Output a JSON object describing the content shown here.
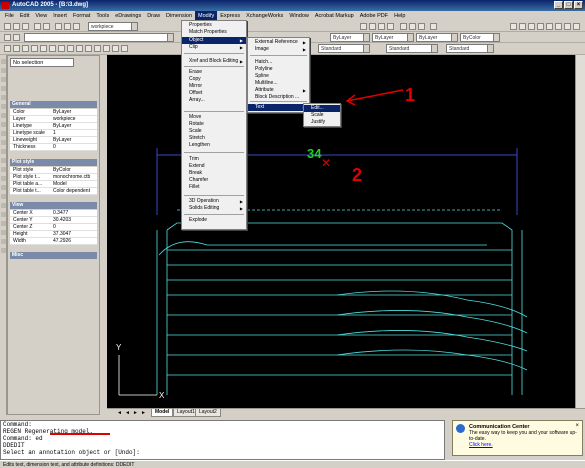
{
  "window": {
    "title": "AutoCAD 2005 - [B:\\3.dwg]"
  },
  "menubar": [
    "File",
    "Edit",
    "View",
    "Insert",
    "Format",
    "Tools",
    "eDrawings",
    "Draw",
    "Dimension",
    "Modify",
    "Express",
    "XchangeWorks",
    "Window",
    "Acrobat Markup",
    "Adobe PDF",
    "Help"
  ],
  "active_menu": "Modify",
  "toolbar": {
    "layer_value": "workpiece",
    "bylayer1": "ByLayer",
    "bylayer2": "ByLayer",
    "bylayer3": "ByLayer",
    "bycolor": "ByColor",
    "standard1": "Standard",
    "standard2": "Standard",
    "standard3": "Standard"
  },
  "properties": {
    "selection": "No selection",
    "general_header": "General",
    "general": [
      {
        "k": "Color",
        "v": "ByLayer"
      },
      {
        "k": "Layer",
        "v": "workpiece"
      },
      {
        "k": "Linetype",
        "v": "ByLayer"
      },
      {
        "k": "Linetype scale",
        "v": "1"
      },
      {
        "k": "Lineweight",
        "v": "ByLayer"
      },
      {
        "k": "Thickness",
        "v": "0"
      }
    ],
    "plot_header": "Plot style",
    "plot": [
      {
        "k": "Plot style",
        "v": "ByColor"
      },
      {
        "k": "Plot style t...",
        "v": "monochrome.ctb"
      },
      {
        "k": "Plot table a...",
        "v": "Model"
      },
      {
        "k": "Plot table t...",
        "v": "Color dependent"
      }
    ],
    "view_header": "View",
    "view": [
      {
        "k": "Center X",
        "v": "0.3477"
      },
      {
        "k": "Center Y",
        "v": "30.4203"
      },
      {
        "k": "Center Z",
        "v": "0"
      },
      {
        "k": "Height",
        "v": "37.3047"
      },
      {
        "k": "Width",
        "v": "47.2926"
      }
    ],
    "misc_header": "Misc"
  },
  "modify_menu": {
    "items": [
      "Properties",
      "Match Properties",
      "Object",
      "Clip",
      "Xref and Block Editing",
      "Erase",
      "Copy",
      "Mirror",
      "Offset",
      "Array...",
      "Move",
      "Rotate",
      "Scale",
      "Stretch",
      "Lengthen",
      "Trim",
      "Extend",
      "Break",
      "Chamfer",
      "Fillet",
      "3D Operation",
      "Solids Editing",
      "Explode"
    ]
  },
  "object_submenu": {
    "items": [
      "External Reference",
      "Image",
      "Hatch...",
      "Polyline",
      "Spline",
      "Multiline...",
      "Attribute",
      "Block Description ...",
      "Text"
    ]
  },
  "text_submenu": {
    "items": [
      "Edit...",
      "Scale",
      "Justify"
    ]
  },
  "annotations": {
    "one": "1",
    "two": "2"
  },
  "drawing": {
    "text": "34",
    "axis_y": "Y",
    "axis_x": "X"
  },
  "tabs": [
    "Model",
    "Layout1",
    "Layout2"
  ],
  "command_lines": [
    "Command:",
    "REGEN Regenerating model.",
    "Command: ed",
    "DDEDIT",
    "Select an annotation object or [Undo]:"
  ],
  "status_text": "Edits text, dimension text, and attribute definitions:  DDEDIT",
  "comm_center": {
    "title": "Communication Center",
    "body": "The easy way to keep you and your software up-to-date.",
    "link": "Click here."
  }
}
